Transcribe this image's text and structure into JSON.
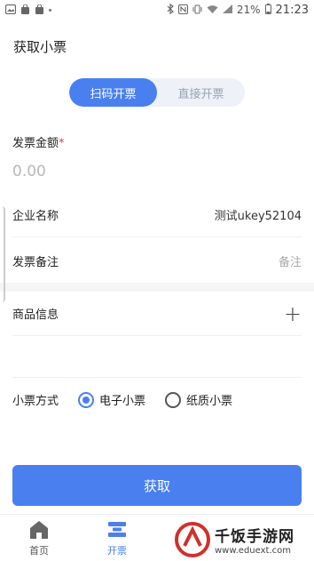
{
  "status_bar": {
    "battery": "21%",
    "time": "21:23",
    "icons_left": [
      "photo-icon",
      "bag-icon",
      "bag-icon"
    ],
    "icons_right": [
      "bluetooth-icon",
      "nfc-icon",
      "vibrate-icon",
      "wifi-icon",
      "signal-icon",
      "battery-icon"
    ]
  },
  "header": {
    "title": "获取小票"
  },
  "segment": {
    "tab_scan": "扫码开票",
    "tab_direct": "直接开票",
    "active": "tab_scan"
  },
  "form": {
    "amount_label": "发票金额",
    "required_mark": "*",
    "amount_placeholder": "0.00",
    "company_label": "企业名称",
    "company_value": "测试ukey52104",
    "remark_label": "发票备注",
    "remark_placeholder": "备注",
    "goods_label": "商品信息",
    "goods_add": "+",
    "method_label": "小票方式",
    "method_options": [
      "电子小票",
      "纸质小票"
    ],
    "method_selected": "电子小票"
  },
  "primary_button": {
    "label": "获取"
  },
  "accent_color": "#4a7ff0",
  "tabbar": {
    "items": [
      {
        "label": "首页",
        "icon": "home-icon"
      },
      {
        "label": "开票",
        "icon": "invoice-icon",
        "active": true
      }
    ]
  },
  "watermark": {
    "main": "千饭手游网",
    "url": "www.eduext.com"
  }
}
